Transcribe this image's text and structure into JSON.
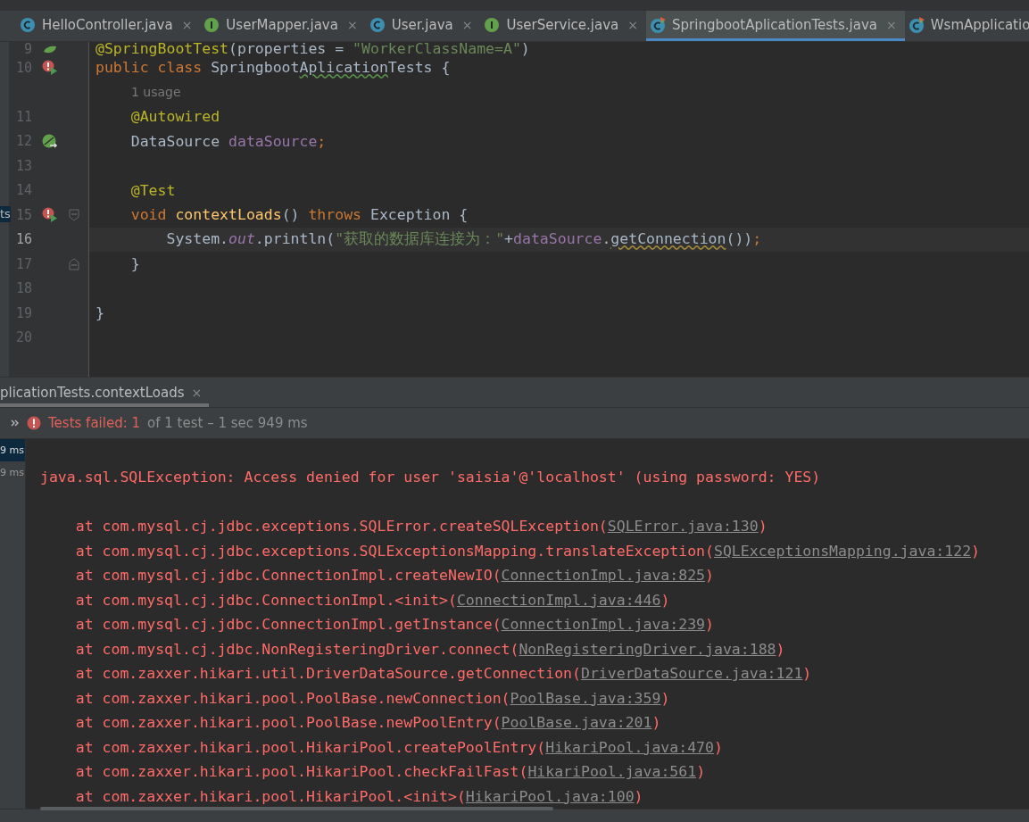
{
  "tabs": [
    {
      "kind": "class",
      "label": "HelloController.java",
      "close": "×",
      "selected": false
    },
    {
      "kind": "interface",
      "label": "UserMapper.java",
      "close": "×",
      "selected": false
    },
    {
      "kind": "class",
      "label": "User.java",
      "close": "×",
      "selected": false
    },
    {
      "kind": "interface",
      "label": "UserService.java",
      "close": "×",
      "selected": false
    },
    {
      "kind": "runnable",
      "label": "SpringbootAplicationTests.java",
      "close": "×",
      "selected": true
    },
    {
      "kind": "runnable",
      "label": "WsmApplicatio",
      "selected": false
    }
  ],
  "project_fragment": "ts",
  "editor": {
    "lines": [
      {
        "number": "9",
        "marker": {
          "kind": "bean"
        },
        "current": false,
        "tokens": [
          {
            "kind": "annotation",
            "text": "@SpringBootTest"
          },
          {
            "kind": "plain",
            "text": "(properties = "
          },
          {
            "kind": "string",
            "text": "\"WorkerClassName=A\""
          },
          {
            "kind": "plain",
            "text": ")"
          }
        ]
      },
      {
        "number": "10",
        "marker": {
          "kind": "run-error"
        },
        "current": false,
        "tokens": [
          {
            "kind": "keyword",
            "text": "public class "
          },
          {
            "kind": "plain",
            "text": "Springboot"
          },
          {
            "kind": "typo",
            "text": "Aplication"
          },
          {
            "kind": "plain",
            "text": "Tests {"
          }
        ]
      },
      {
        "tokens": [
          {
            "kind": "hint",
            "text": "1 usage"
          }
        ]
      },
      {
        "number": "11",
        "current": false,
        "tokens": [
          {
            "kind": "annotation",
            "text": "    @Autowired"
          }
        ]
      },
      {
        "number": "12",
        "marker": {
          "kind": "bean-link"
        },
        "current": false,
        "tokens": [
          {
            "kind": "plain",
            "text": "    DataSource "
          },
          {
            "kind": "field",
            "text": "dataSource"
          },
          {
            "kind": "keyword",
            "text": ";"
          }
        ]
      },
      {
        "number": "13",
        "current": false
      },
      {
        "number": "14",
        "current": false,
        "tokens": [
          {
            "kind": "annotation",
            "text": "    @Test"
          }
        ]
      },
      {
        "number": "15",
        "marker": {
          "kind": "run-error"
        },
        "fold": {
          "kind": "start"
        },
        "current": false,
        "tokens": [
          {
            "kind": "keyword",
            "text": "    void "
          },
          {
            "kind": "method",
            "text": "contextLoads"
          },
          {
            "kind": "plain",
            "text": "() "
          },
          {
            "kind": "keyword",
            "text": "throws "
          },
          {
            "kind": "plain",
            "text": "Exception {"
          }
        ]
      },
      {
        "number": "16",
        "current": true,
        "tokens": [
          {
            "kind": "plain",
            "text": "        System."
          },
          {
            "kind": "static",
            "text": "out"
          },
          {
            "kind": "plain",
            "text": ".println("
          },
          {
            "kind": "string",
            "text": "\"获取的数据库连接为：\""
          },
          {
            "kind": "plain",
            "text": "+"
          },
          {
            "kind": "field",
            "text": "dataSource"
          },
          {
            "kind": "plain",
            "text": "."
          },
          {
            "kind": "warn",
            "text": "getConnection"
          },
          {
            "kind": "plain",
            "text": "())"
          },
          {
            "kind": "keyword",
            "text": ";"
          }
        ]
      },
      {
        "number": "17",
        "fold": {
          "kind": "end"
        },
        "current": false,
        "tokens": [
          {
            "kind": "plain",
            "text": "    }"
          }
        ]
      },
      {
        "number": "18",
        "current": false
      },
      {
        "number": "19",
        "current": false,
        "tokens": [
          {
            "kind": "plain",
            "text": "}"
          }
        ]
      },
      {
        "number": "20",
        "current": false
      }
    ]
  },
  "run_panel": {
    "tab": {
      "label": "plicationTests.contextLoads",
      "close": "×",
      "selected": true
    },
    "status": {
      "failed": "Tests failed: 1",
      "detail": "of 1 test – 1 sec 949 ms"
    },
    "tree": [
      {
        "label": "9 ms",
        "selected": true
      },
      {
        "label": "9 ms",
        "selected": false
      }
    ],
    "console": [
      {
        "kind": "message",
        "text": "java.sql.SQLException: Access denied for user 'saisia'@'localhost' (using password: YES)"
      },
      {
        "kind": "blank"
      },
      {
        "kind": "frame",
        "prefix": "    at com.mysql.cj.jdbc.exceptions.SQLError.createSQLException(",
        "link": "SQLError.java:130",
        "suffix": ")"
      },
      {
        "kind": "frame",
        "prefix": "    at com.mysql.cj.jdbc.exceptions.SQLExceptionsMapping.translateException(",
        "link": "SQLExceptionsMapping.java:122",
        "suffix": ")"
      },
      {
        "kind": "frame",
        "prefix": "    at com.mysql.cj.jdbc.ConnectionImpl.createNewIO(",
        "link": "ConnectionImpl.java:825",
        "suffix": ")"
      },
      {
        "kind": "frame",
        "prefix": "    at com.mysql.cj.jdbc.ConnectionImpl.<init>(",
        "link": "ConnectionImpl.java:446",
        "suffix": ")"
      },
      {
        "kind": "frame",
        "prefix": "    at com.mysql.cj.jdbc.ConnectionImpl.getInstance(",
        "link": "ConnectionImpl.java:239",
        "suffix": ")"
      },
      {
        "kind": "frame",
        "prefix": "    at com.mysql.cj.jdbc.NonRegisteringDriver.connect(",
        "link": "NonRegisteringDriver.java:188",
        "suffix": ")"
      },
      {
        "kind": "frame",
        "prefix": "    at com.zaxxer.hikari.util.DriverDataSource.getConnection(",
        "link": "DriverDataSource.java:121",
        "suffix": ")"
      },
      {
        "kind": "frame",
        "prefix": "    at com.zaxxer.hikari.pool.PoolBase.newConnection(",
        "link": "PoolBase.java:359",
        "suffix": ")"
      },
      {
        "kind": "frame",
        "prefix": "    at com.zaxxer.hikari.pool.PoolBase.newPoolEntry(",
        "link": "PoolBase.java:201",
        "suffix": ")"
      },
      {
        "kind": "frame",
        "prefix": "    at com.zaxxer.hikari.pool.HikariPool.createPoolEntry(",
        "link": "HikariPool.java:470",
        "suffix": ")"
      },
      {
        "kind": "frame",
        "prefix": "    at com.zaxxer.hikari.pool.HikariPool.checkFailFast(",
        "link": "HikariPool.java:561",
        "suffix": ")"
      },
      {
        "kind": "frame",
        "prefix": "    at com.zaxxer.hikari.pool.HikariPool.<init>(",
        "link": "HikariPool.java:100",
        "suffix": ")"
      }
    ]
  }
}
